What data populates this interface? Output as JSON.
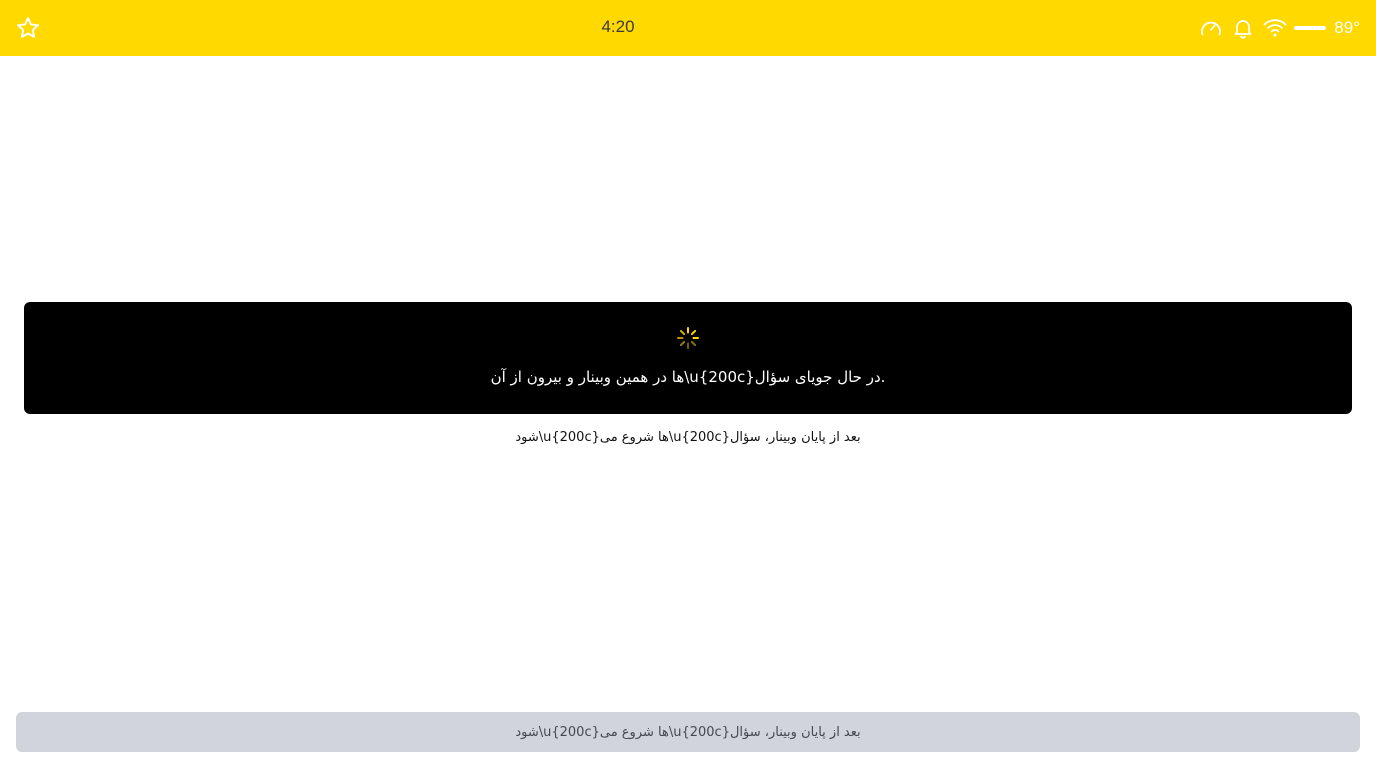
{
  "status_bar": {
    "time": "4:20",
    "temperature": "89°",
    "background_color": "#FFD900",
    "icons": [
      "star-icon",
      "speedometer-icon",
      "bell-icon",
      "wifi-icon",
      "line-icon"
    ]
  },
  "main": {
    "card": {
      "spinner_color": "#FFD900",
      "message": "ها در همین وبینار و بیرون از آن\\u{200c}در حال جویای سؤال."
    },
    "subtitle": "شود\\u{200c}ها شروع می\\u{200c}بعد از پایان وبینار، سؤال"
  },
  "footer": {
    "button_label": "شود\\u{200c}ها شروع می\\u{200c}بعد از پایان وبینار، سؤال"
  }
}
